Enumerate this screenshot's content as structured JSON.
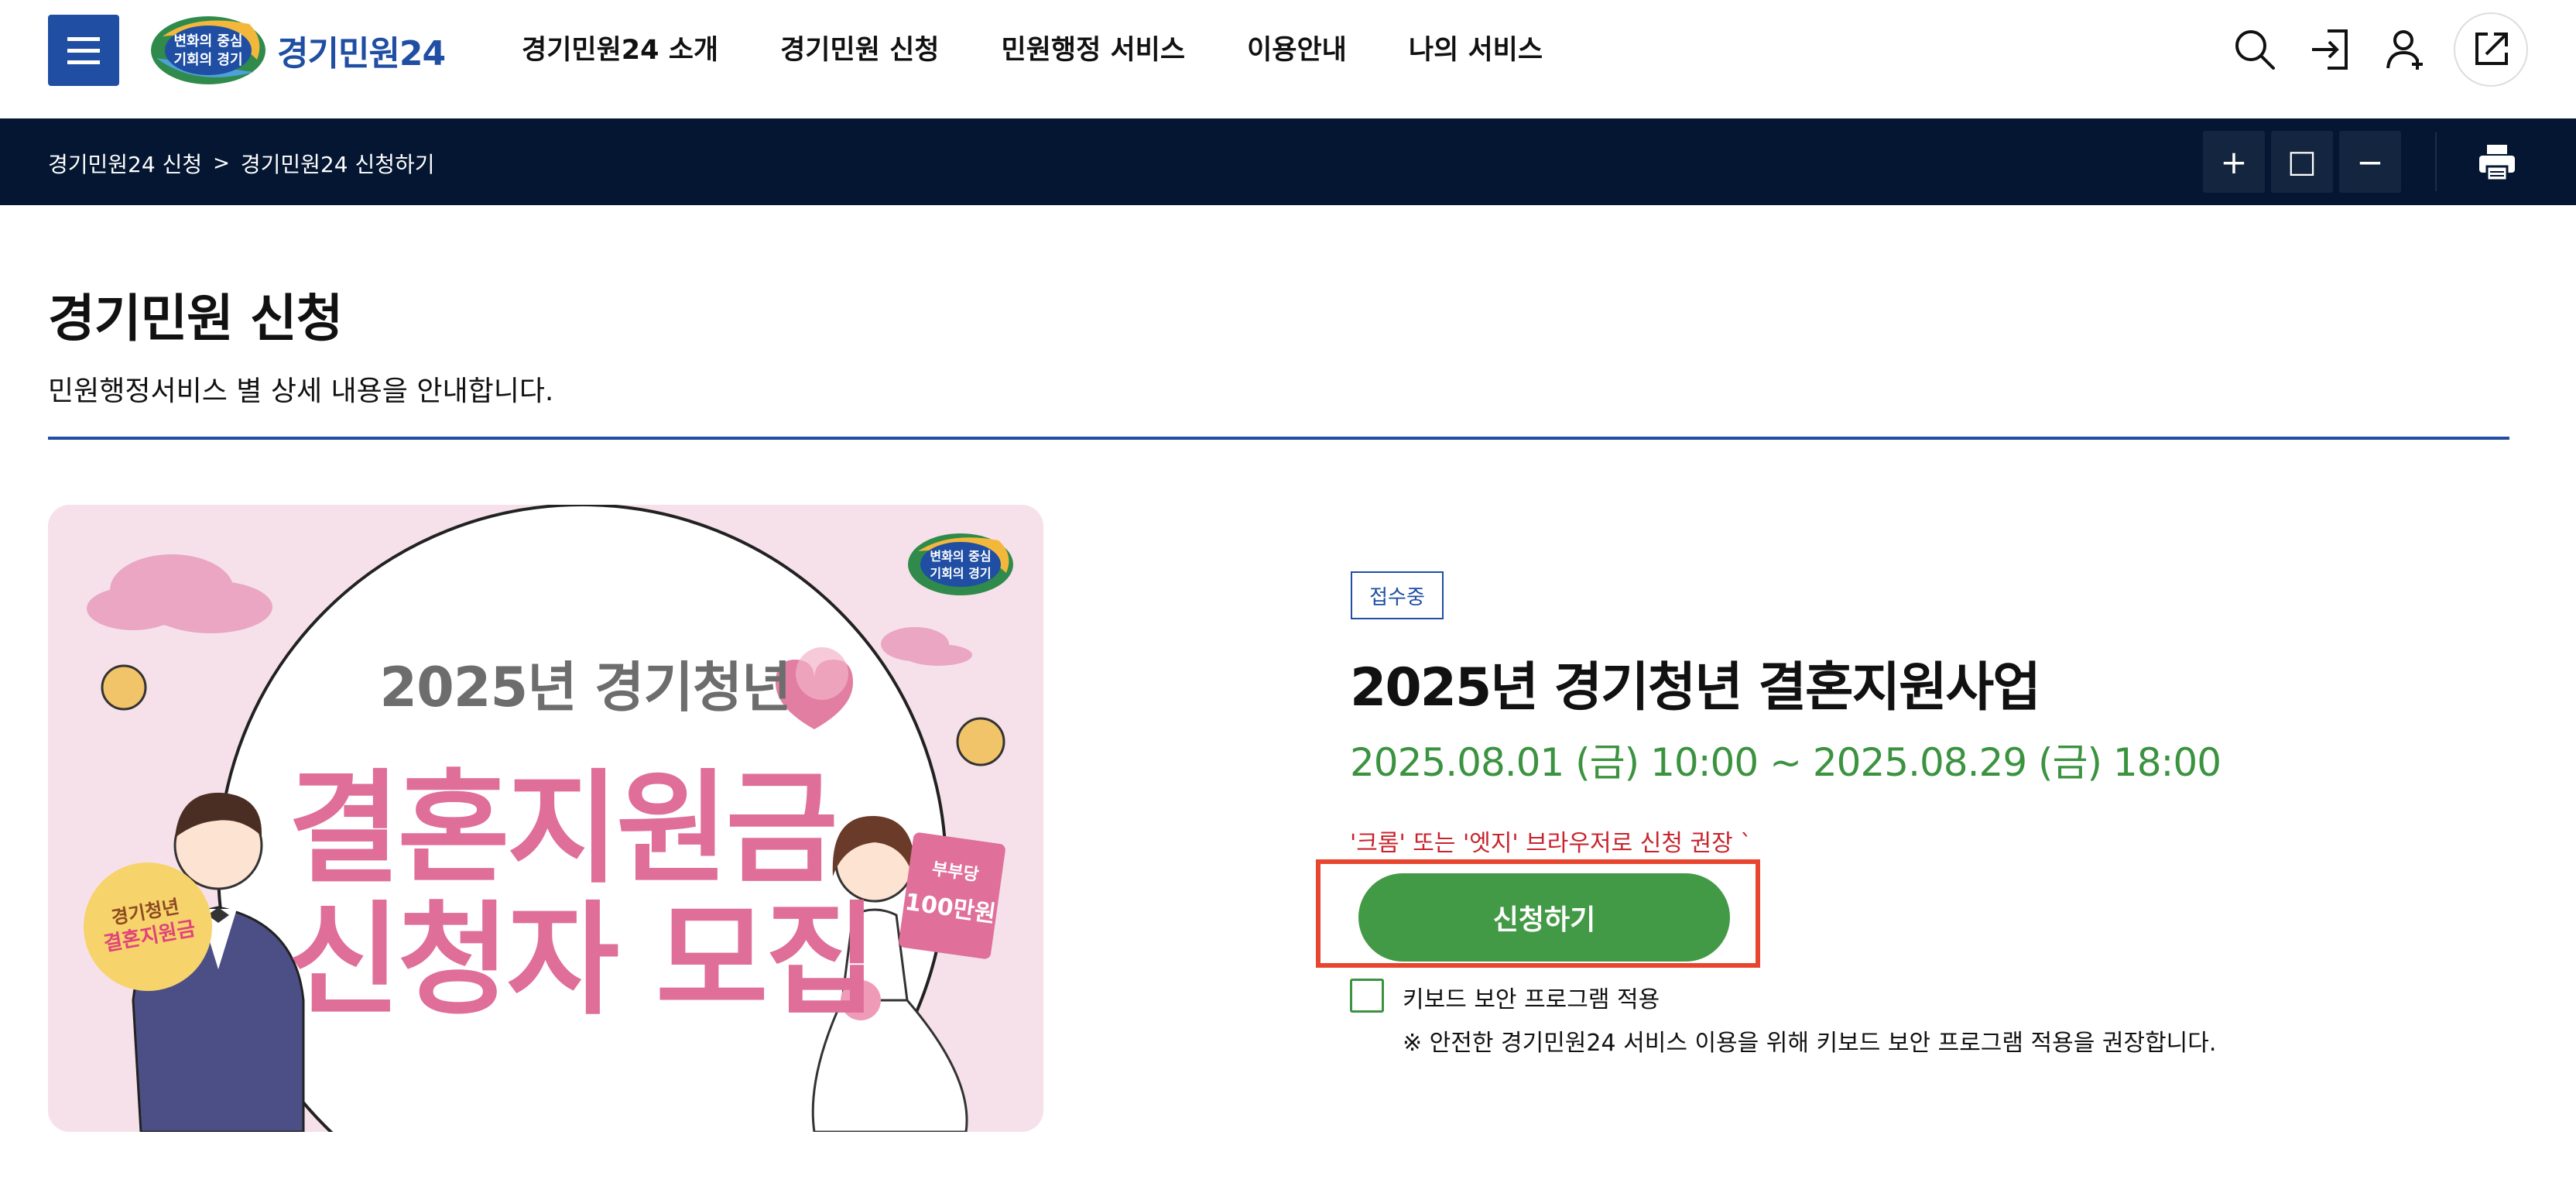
{
  "header": {
    "logo_badge_line1": "변화의 중심",
    "logo_badge_line2": "기회의 경기",
    "logo_text": "경기민원24",
    "nav": [
      {
        "label": "경기민원24 소개"
      },
      {
        "label": "경기민원 신청"
      },
      {
        "label": "민원행정 서비스"
      },
      {
        "label": "이용안내"
      },
      {
        "label": "나의 서비스"
      }
    ],
    "utility_icons": [
      "search-icon",
      "login-icon",
      "signup-icon",
      "external-link-icon"
    ]
  },
  "breadcrumb": {
    "items": [
      "경기민원24 신청",
      "경기민원24 신청하기"
    ],
    "separator": ">"
  },
  "zoom_tools": {
    "zoom_in": "+",
    "reset": "□",
    "zoom_out": "−",
    "print_icon": "printer-icon"
  },
  "page": {
    "title": "경기민원 신청",
    "description": "민원행정서비스 별 상세 내용을 안내합니다."
  },
  "banner": {
    "subtitle": "2025년 경기청년",
    "main_line1": "결혼지원금",
    "main_line2": "신청자 모집",
    "left_badge_line1": "경기청년",
    "left_badge_line2": "결혼지원금",
    "card_small": "부부당",
    "card_big": "100만원",
    "logo_line1": "변화의 중심",
    "logo_line2": "기회의 경기"
  },
  "service": {
    "status": "접수중",
    "title": "2025년 경기청년 결혼지원사업",
    "period": "2025.08.01 (금) 10:00 ~ 2025.08.29 (금) 18:00",
    "browser_note": "'크롬' 또는 '엣지' 브라우저로 신청 권장 `",
    "apply_label": "신청하기",
    "keyboard_security_label": "키보드 보안 프로그램 적용",
    "keyboard_security_checked": false,
    "keyboard_notice": "※ 안전한 경기민원24 서비스 이용을 위해 키보드 보안 프로그램 적용을 권장합니다."
  },
  "colors": {
    "brand_blue": "#1f4ea3",
    "dark_navy": "#041631",
    "accent_green": "#439a46",
    "warning_red": "#c8242e",
    "highlight_border": "#e8452f",
    "banner_pink": "#df6e99"
  }
}
